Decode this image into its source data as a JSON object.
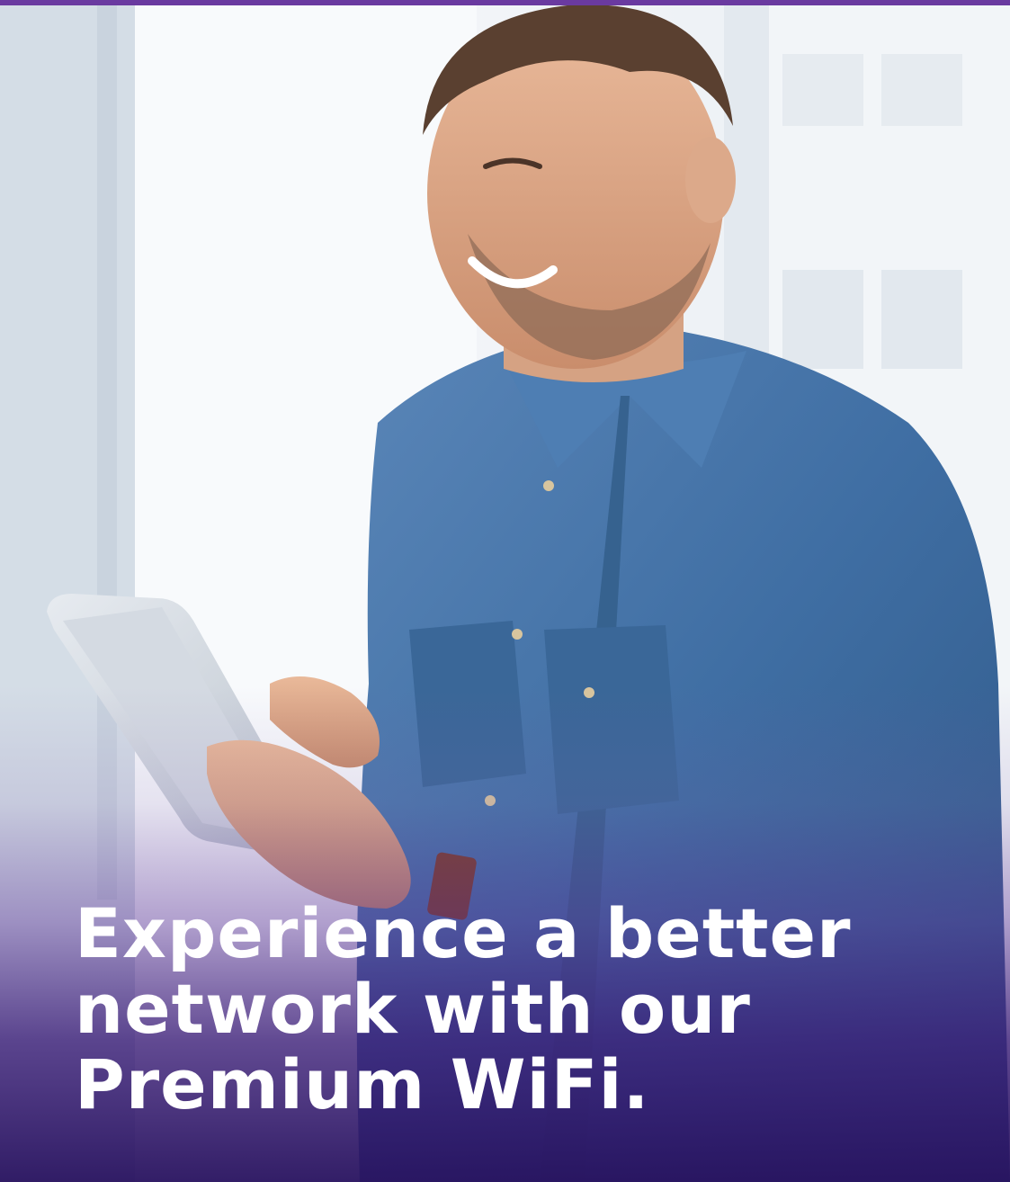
{
  "banner": {
    "headline_lines": [
      "Experience a better",
      "network with our",
      "Premium WiFi."
    ]
  },
  "colors": {
    "accent_strip": "#6a3aa0",
    "overlay_dark": "#28125f",
    "headline_text": "#ffffff",
    "shirt_denim": "#3f6ea3"
  }
}
